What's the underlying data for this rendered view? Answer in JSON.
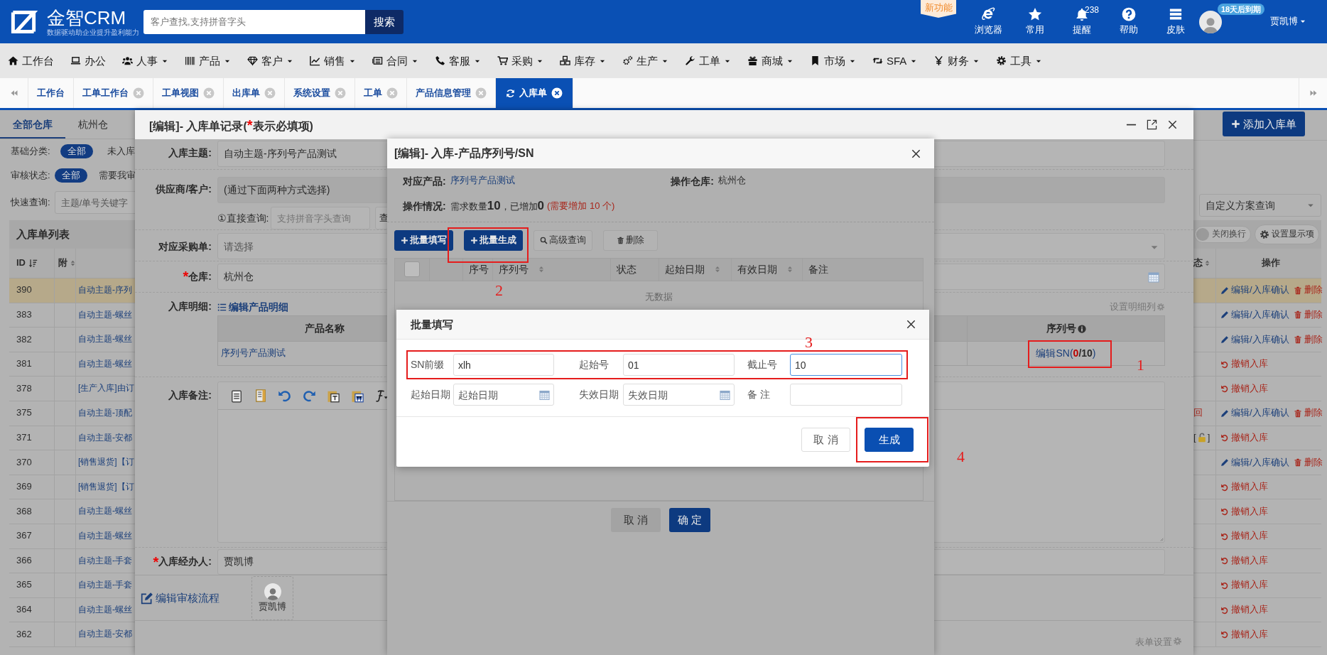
{
  "header": {
    "logo_text": "金智CRM",
    "logo_slogan": "数据驱动助企业提升盈利能力",
    "search": {
      "placeholder": "客户查找,支持拼音字头",
      "button": "搜索"
    },
    "new_feature_badge": "新功能",
    "tools": [
      {
        "label": "浏览器"
      },
      {
        "label": "常用"
      },
      {
        "label": "提醒",
        "count": "238"
      },
      {
        "label": "帮助"
      },
      {
        "label": "皮肤"
      }
    ],
    "user": {
      "expiry_badge": "18天后到期",
      "name": "贾凯博"
    }
  },
  "menu": [
    {
      "label": "工作台",
      "dropdown": false
    },
    {
      "label": "办公",
      "dropdown": false
    },
    {
      "label": "人事",
      "dropdown": true
    },
    {
      "label": "产品",
      "dropdown": true
    },
    {
      "label": "客户",
      "dropdown": true
    },
    {
      "label": "销售",
      "dropdown": true
    },
    {
      "label": "合同",
      "dropdown": true
    },
    {
      "label": "客服",
      "dropdown": true
    },
    {
      "label": "采购",
      "dropdown": true
    },
    {
      "label": "库存",
      "dropdown": true
    },
    {
      "label": "生产",
      "dropdown": true
    },
    {
      "label": "工单",
      "dropdown": true
    },
    {
      "label": "商城",
      "dropdown": true
    },
    {
      "label": "市场",
      "dropdown": true
    },
    {
      "label": "SFA",
      "dropdown": true
    },
    {
      "label": "财务",
      "dropdown": true
    },
    {
      "label": "工具",
      "dropdown": true
    }
  ],
  "tabs": [
    {
      "label": "工作台",
      "closable": false,
      "selected": false
    },
    {
      "label": "工单工作台",
      "closable": true,
      "selected": false
    },
    {
      "label": "工单视图",
      "closable": true,
      "selected": false
    },
    {
      "label": "出库单",
      "closable": true,
      "selected": false
    },
    {
      "label": "系统设置",
      "closable": true,
      "selected": false
    },
    {
      "label": "工单",
      "closable": true,
      "selected": false
    },
    {
      "label": "产品信息管理",
      "closable": true,
      "selected": false
    },
    {
      "label": "入库单",
      "closable": true,
      "selected": true
    }
  ],
  "page": {
    "warehouse_tabs": [
      {
        "label": "全部仓库",
        "selected": true
      },
      {
        "label": "杭州仓",
        "selected": false
      }
    ],
    "filters": [
      {
        "label": "基础分类:",
        "options": [
          {
            "label": "全部",
            "selected": true
          },
          {
            "label": "未入库",
            "selected": false
          }
        ]
      },
      {
        "label": "审核状态:",
        "options": [
          {
            "label": "全部",
            "selected": true
          },
          {
            "label": "需要我审",
            "selected": false
          }
        ]
      }
    ],
    "quick_search": {
      "label": "快速查询:",
      "placeholder": "主题/单号关键字"
    },
    "add_button": "添加入库单",
    "scheme_select": {
      "value": "自定义方案查询"
    },
    "list_title": "入库单列表",
    "wrap_toggle": {
      "label": "关闭换行",
      "on": false
    },
    "display_settings_button": "设置显示项",
    "left_columns": [
      {
        "label": "ID"
      },
      {
        "label": "附"
      }
    ],
    "right_columns": [
      {
        "label": "态"
      },
      {
        "label": "操作"
      }
    ],
    "rows": [
      {
        "id": "390",
        "subject": "自动主题-序列",
        "selected": true,
        "actions": [
          {
            "kind": "edit",
            "label": "编辑/入库确认"
          },
          {
            "kind": "delete",
            "label": "删除"
          }
        ]
      },
      {
        "id": "383",
        "subject": "自动主题-螺丝",
        "selected": false,
        "actions": [
          {
            "kind": "edit",
            "label": "编辑/入库确认"
          },
          {
            "kind": "delete",
            "label": "删除"
          }
        ]
      },
      {
        "id": "382",
        "subject": "自动主题-螺丝",
        "selected": false,
        "actions": [
          {
            "kind": "edit",
            "label": "编辑/入库确认"
          },
          {
            "kind": "delete",
            "label": "删除"
          }
        ]
      },
      {
        "id": "381",
        "subject": "自动主题-螺丝",
        "selected": false,
        "actions": [
          {
            "kind": "revoke",
            "label": "撤销入库"
          }
        ]
      },
      {
        "id": "378",
        "subject": "[生产入库]由订",
        "selected": false,
        "actions": [
          {
            "kind": "revoke",
            "label": "撤销入库"
          }
        ]
      },
      {
        "id": "375",
        "subject": "自动主题-顶配",
        "selected": false,
        "status": {
          "kind": "text",
          "text": "回"
        },
        "actions": [
          {
            "kind": "edit",
            "label": "编辑/入库确认"
          },
          {
            "kind": "delete",
            "label": "删除"
          }
        ]
      },
      {
        "id": "371",
        "subject": "自动主题-安都",
        "selected": false,
        "status": {
          "kind": "lock",
          "before": "[",
          "after": "]"
        },
        "actions": [
          {
            "kind": "revoke",
            "label": "撤销入库"
          }
        ]
      },
      {
        "id": "370",
        "subject": "[销售退货]【订",
        "selected": false,
        "actions": [
          {
            "kind": "edit",
            "label": "编辑/入库确认"
          },
          {
            "kind": "delete",
            "label": "删除"
          }
        ]
      },
      {
        "id": "369",
        "subject": "[销售退货]【订",
        "selected": false,
        "actions": [
          {
            "kind": "revoke",
            "label": "撤销入库"
          }
        ]
      },
      {
        "id": "368",
        "subject": "自动主题-螺丝",
        "selected": false,
        "actions": [
          {
            "kind": "revoke",
            "label": "撤销入库"
          }
        ]
      },
      {
        "id": "367",
        "subject": "自动主题-螺丝",
        "selected": false,
        "actions": [
          {
            "kind": "revoke",
            "label": "撤销入库"
          }
        ]
      },
      {
        "id": "366",
        "subject": "自动主题-手套",
        "selected": false,
        "actions": [
          {
            "kind": "revoke",
            "label": "撤销入库"
          }
        ]
      },
      {
        "id": "365",
        "subject": "自动主题-手套",
        "selected": false,
        "actions": [
          {
            "kind": "revoke",
            "label": "撤销入库"
          }
        ]
      },
      {
        "id": "364",
        "subject": "自动主题-螺丝",
        "selected": false,
        "actions": [
          {
            "kind": "revoke",
            "label": "撤销入库"
          }
        ]
      },
      {
        "id": "362",
        "subject": "自动主题-安都",
        "selected": false,
        "actions": [
          {
            "kind": "revoke",
            "label": "撤销入库"
          }
        ]
      }
    ]
  },
  "record_dialog": {
    "title_prefix": "[编辑]- 入库单记录(",
    "required_mark": "*",
    "title_suffix": "表示必填项)",
    "subject": {
      "label": "入库主题:",
      "value": "自动主题-序列号产品测试"
    },
    "supplier": {
      "label": "供应商/客户:",
      "value": "(通过下面两种方式选择)",
      "direct_query": {
        "label": "①直接查询:",
        "placeholder": "支持拼音字头查询",
        "button": "查"
      }
    },
    "purchase_order": {
      "label": "对应采购单:",
      "placeholder": "请选择"
    },
    "warehouse": {
      "label": "仓库:",
      "required": true,
      "value": "杭州仓"
    },
    "details": {
      "label": "入库明细:",
      "edit_link": "编辑产品明细",
      "settings_link": "设置明细列",
      "columns": [
        {
          "label": "产品名称",
          "info": false
        },
        {
          "label": "序列号",
          "info": true
        }
      ],
      "rows": [
        {
          "product": "序列号产品测试",
          "sn_prefix": "编辑SN(",
          "sn_done": "0",
          "sn_total": "/10",
          "sn_suffix": ")"
        }
      ]
    },
    "remarks": {
      "label": "入库备注:"
    },
    "handler": {
      "label": "入库经办人:",
      "required": true,
      "value": "贾凯博"
    },
    "approval": {
      "link": "编辑审核流程",
      "approvers": [
        {
          "name": "贾凯博"
        }
      ]
    },
    "form_settings": "表单设置"
  },
  "sn_dialog": {
    "title": "[编辑]- 入库-产品序列号/SN",
    "product_label": "对应产品:",
    "product": "序列号产品测试",
    "warehouse_label": "操作仓库:",
    "warehouse": "杭州仓",
    "status_label": "操作情况:",
    "status": "需求数量**10**，已增加**0**",
    "status_note": "(需要增加 10 个)",
    "buttons": [
      {
        "kind": "primary",
        "label": "批量填写"
      },
      {
        "kind": "primary",
        "label": "批量生成"
      },
      {
        "kind": "search",
        "label": "高级查询"
      },
      {
        "kind": "delete",
        "label": "删除"
      }
    ],
    "columns": [
      {
        "kind": "checkbox",
        "checked": false
      },
      {
        "kind": "blank"
      },
      {
        "kind": "text",
        "label": "序号"
      },
      {
        "kind": "sortable",
        "label": "序列号"
      },
      {
        "kind": "text",
        "label": "状态"
      },
      {
        "kind": "sortable",
        "label": "起始日期"
      },
      {
        "kind": "sortable",
        "label": "有效日期"
      },
      {
        "kind": "text",
        "label": "备注"
      }
    ],
    "empty_text": "无数据",
    "cancel": "取 消",
    "confirm": "确 定"
  },
  "batch_dialog": {
    "title": "批量填写",
    "fields": [
      {
        "kind": "text",
        "label": "SN前缀",
        "value": "xlh",
        "focused": false
      },
      {
        "kind": "text",
        "label": "起始号",
        "value": "01",
        "focused": false
      },
      {
        "kind": "text",
        "label": "截止号",
        "value": "10",
        "focused": true
      },
      {
        "kind": "date",
        "label": "起始日期",
        "placeholder": "起始日期"
      },
      {
        "kind": "date",
        "label": "失效日期",
        "placeholder": "失效日期"
      },
      {
        "kind": "text",
        "label": "备 注",
        "focused": false
      }
    ],
    "cancel": "取 消",
    "submit": "生成"
  },
  "annotations": [
    {
      "number": "1"
    },
    {
      "number": "2"
    },
    {
      "number": "3"
    },
    {
      "number": "4"
    }
  ]
}
